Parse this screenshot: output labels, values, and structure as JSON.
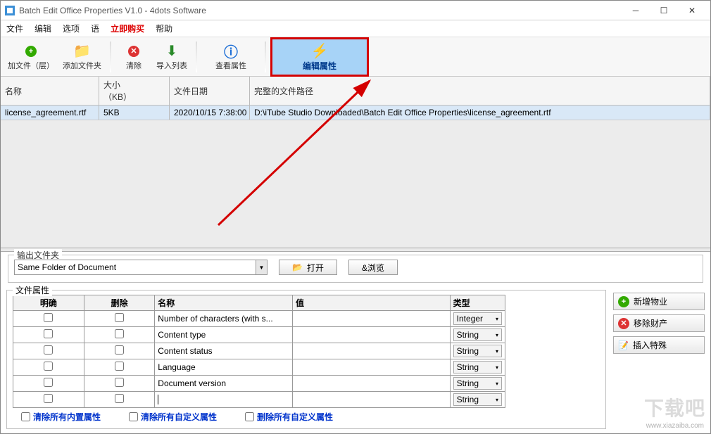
{
  "window": {
    "title": "Batch Edit Office Properties V1.0 - 4dots Software"
  },
  "menu": {
    "file": "文件",
    "edit": "编辑",
    "options": "选项",
    "language": "语",
    "buynow": "立即购买",
    "help": "帮助"
  },
  "toolbar": {
    "addfiles": "加文件（层）",
    "addfolder": "添加文件夹",
    "clear": "清除",
    "import": "导入列表",
    "viewprops": "查看属性",
    "editprops": "编辑属性"
  },
  "grid": {
    "headers": {
      "name": "名称",
      "size_line1": "大小",
      "size_line2": "（KB）",
      "date": "文件日期",
      "path": "完整的文件路径"
    },
    "rows": [
      {
        "name": "license_agreement.rtf",
        "size": "5KB",
        "date": "2020/10/15 7:38:00",
        "path": "D:\\iTube Studio Downloaded\\Batch Edit Office Properties\\license_agreement.rtf"
      }
    ]
  },
  "output": {
    "legend": "输出文件夹",
    "combo": "Same Folder of Document",
    "open": "打开",
    "browse": "&浏览"
  },
  "props": {
    "legend": "文件属性",
    "headers": {
      "explicit": "明确",
      "delete": "删除",
      "name": "名称",
      "value": "值",
      "type": "类型"
    },
    "rows": [
      {
        "name": "Number of characters (with s...",
        "value": "",
        "type": "Integer"
      },
      {
        "name": "Content type",
        "value": "",
        "type": "String"
      },
      {
        "name": "Content status",
        "value": "",
        "type": "String"
      },
      {
        "name": "Language",
        "value": "",
        "type": "String"
      },
      {
        "name": "Document version",
        "value": "",
        "type": "String"
      },
      {
        "name": "",
        "value": "",
        "type": "String"
      }
    ],
    "side": {
      "add": "新增物业",
      "remove": "移除财产",
      "insert": "插入特殊"
    }
  },
  "footer": {
    "clear_builtin": "清除所有内置属性",
    "clear_custom": "清除所有自定义属性",
    "delete_custom": "删除所有自定义属性"
  },
  "watermark": {
    "brand": "下载吧",
    "url": "www.xiazaiba.com"
  }
}
